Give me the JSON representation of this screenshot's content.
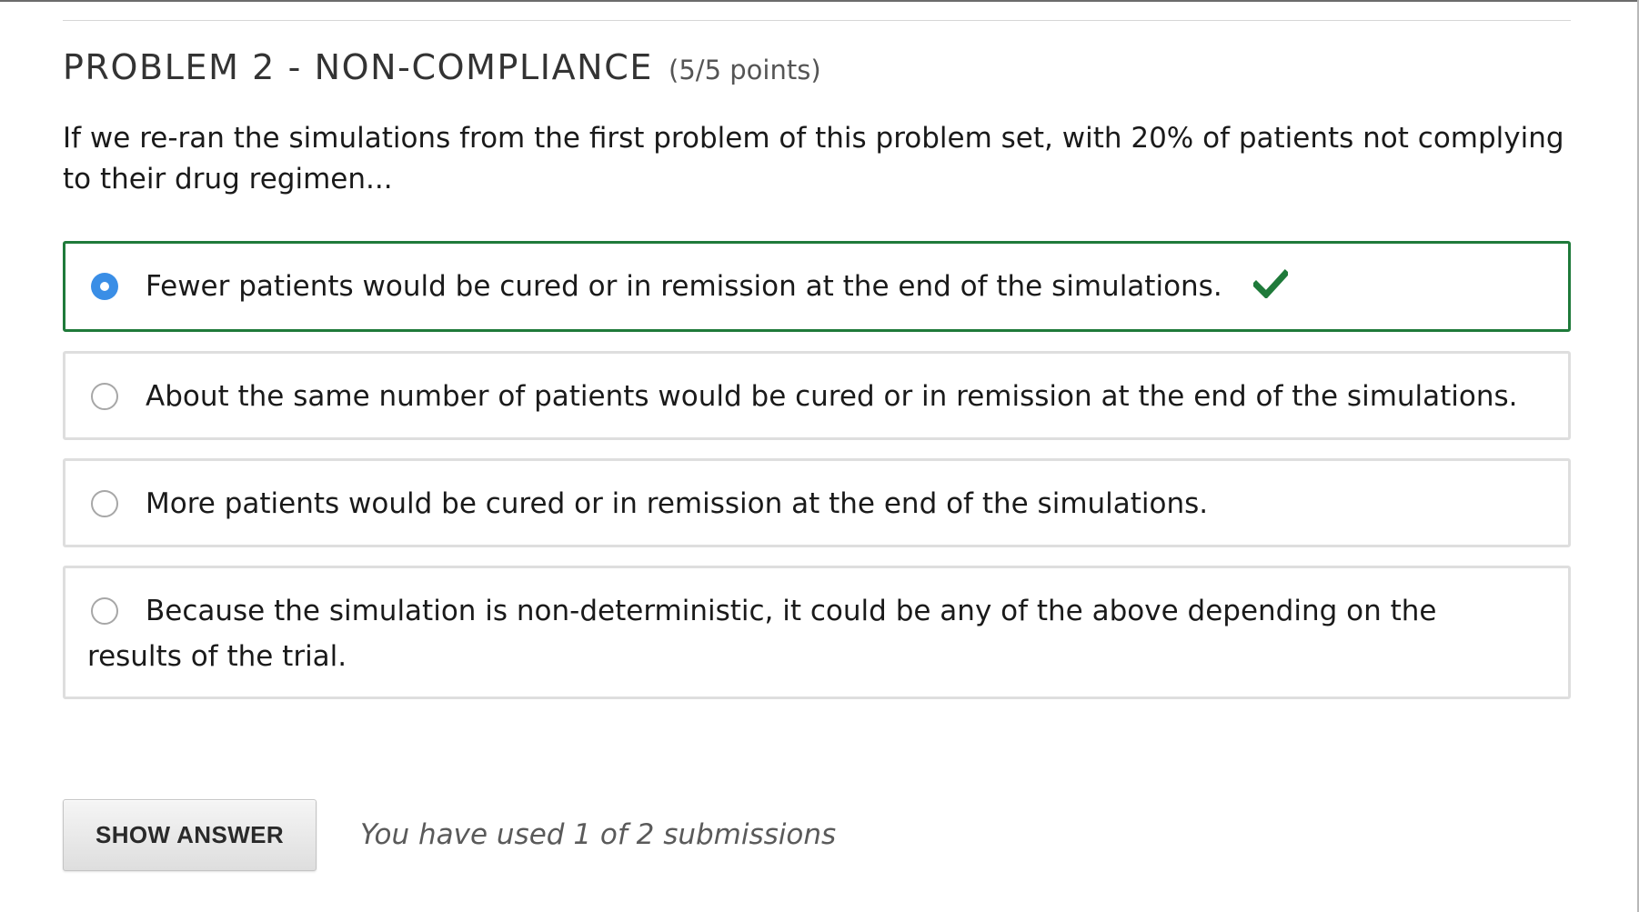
{
  "problem": {
    "title": "PROBLEM 2 - NON-COMPLIANCE",
    "points": "(5/5 points)",
    "question": "If we re-ran the simulations from the first problem of this problem set, with 20% of patients not complying to their drug regimen..."
  },
  "choices": [
    {
      "label": "Fewer patients would be cured or in remission at the end of the simulations.",
      "selected": true,
      "status": "correct",
      "status_icon": "checkmark-icon"
    },
    {
      "label": "About the same number of patients would be cured or in remission at the end of the simulations.",
      "selected": false
    },
    {
      "label": "More patients would be cured or in remission at the end of the simulations.",
      "selected": false
    },
    {
      "label": "Because the simulation is non-deterministic, it could be any of the above depending on the results of the trial.",
      "selected": false
    }
  ],
  "actions": {
    "show_answer_label": "SHOW ANSWER",
    "submission_status": "You have used 1 of 2 submissions"
  },
  "colors": {
    "correct_border": "#1f7a3a",
    "checkmark": "#1f7a3a",
    "selected_radio": "#3a8ee6",
    "choice_border": "#dedede"
  }
}
